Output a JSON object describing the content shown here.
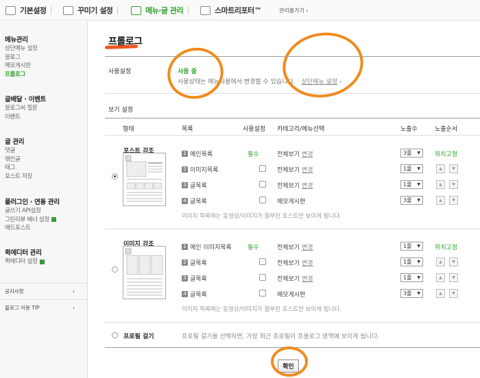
{
  "topnav": {
    "tabs": [
      {
        "label": "기본설정",
        "icon": "settings-icon"
      },
      {
        "label": "꾸미기 설정",
        "icon": "design-icon"
      },
      {
        "label": "메뉴·글 관리",
        "icon": "menu-icon"
      },
      {
        "label": "스마트리포터™",
        "icon": "chart-icon"
      }
    ],
    "admin_link": "관리홈가기 ›"
  },
  "sidebar": {
    "groups": [
      {
        "title": "메뉴관리",
        "items": [
          "상단메뉴 설정",
          "블로그",
          "메모게시판",
          "프롤로그"
        ]
      },
      {
        "title": "글배달 · 이벤트",
        "items": [
          "블로그씨 질문",
          "이벤트"
        ]
      },
      {
        "title": "글 관리",
        "items": [
          "댓글",
          "엮인글",
          "태그",
          "포스트 저장"
        ]
      },
      {
        "title": "플러그인 · 연동 관리",
        "items": [
          "글쓰기 API설정",
          "그린리뷰 배너 설정",
          "애드포스트"
        ]
      },
      {
        "title": "퀵에디터 관리",
        "items": [
          "퀵에디터 설정"
        ]
      }
    ],
    "footer": [
      {
        "label": "공지사항",
        "arrow": "›"
      },
      {
        "label": "블로그 이용 TIP",
        "arrow": "›"
      }
    ]
  },
  "main": {
    "title": "프롤로그",
    "usage": {
      "label": "사용설정",
      "status": "사용 중",
      "desc": "사용상태는 메뉴사용에서 변경할 수 있습니다.",
      "link": "상단메뉴 설정",
      "link_arrow": "›"
    },
    "view": {
      "label": "보기 설정",
      "headers": [
        "형태",
        "목록",
        "사용설정",
        "카테고리/메뉴선택",
        "노출수",
        "노출순서"
      ],
      "blocks": [
        {
          "title": "포스트 강조",
          "rows": [
            {
              "num": "1",
              "name": "메인목록",
              "required": "필수",
              "category": "전체보기",
              "change": "변경",
              "count": "3줄",
              "order": "위치고정"
            },
            {
              "num": "2",
              "name": "이미지목록",
              "category": "전체보기",
              "change": "변경",
              "count": "1줄"
            },
            {
              "num": "3",
              "name": "글목록",
              "category": "전체보기",
              "change": "변경",
              "count": "1줄"
            },
            {
              "num": "4",
              "name": "글목록",
              "category": "메모게시판",
              "count": "3줄"
            }
          ],
          "note": "이미지 목록에는 동영상/이미지가 첨부된 포스트만 보이게 됩니다."
        },
        {
          "title": "이미지 강조",
          "rows": [
            {
              "num": "1",
              "name": "메인 이미지목록",
              "required": "필수",
              "category": "전체보기",
              "change": "변경",
              "count": "1줄",
              "order": "위치고정"
            },
            {
              "num": "2",
              "name": "글목록",
              "category": "전체보기",
              "change": "변경",
              "count": "1줄"
            },
            {
              "num": "3",
              "name": "글목록",
              "category": "전체보기",
              "change": "변경",
              "count": "1줄"
            },
            {
              "num": "4",
              "name": "글목록",
              "category": "메모게시판",
              "count": "3줄"
            }
          ],
          "note": "이미지 목록에는 동영상/이미지가 첨부된 포스트만 보이게 됩니다."
        }
      ],
      "profile": {
        "label": "프로필 걸기",
        "desc": "프로필 걸기를 선택하면, 가장 최근 프로필이 프롤로그 영역에 보이게 됩니다."
      }
    },
    "confirm": "확인"
  },
  "colors": {
    "accent": "#2aa12a",
    "annotation": "#f08a1d"
  }
}
